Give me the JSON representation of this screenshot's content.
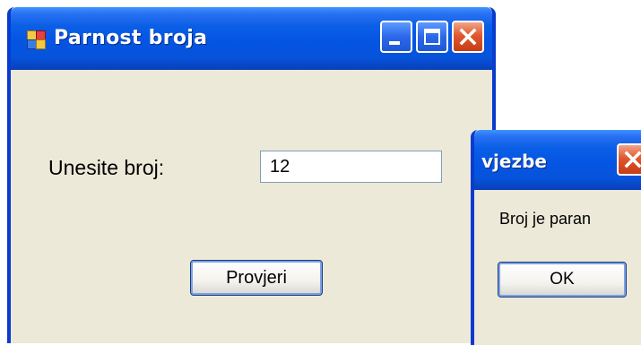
{
  "main_window": {
    "title": "Parnost broja",
    "icon": "app-window-icon",
    "titlebar_buttons": [
      "minimize-icon",
      "maximize-icon",
      "close-icon"
    ],
    "label": "Unesite broj:",
    "input_value": "12",
    "button_label": "Provjeri"
  },
  "message_box": {
    "title": "vjezbe",
    "text": "Broj je paran",
    "ok_label": "OK",
    "close_icon": "close-icon"
  },
  "colors": {
    "titlebar_blue": "#0554e3",
    "window_frame": "#0a3bcf",
    "window_body": "#ece9d8",
    "close_button_red": "#e0582f"
  }
}
